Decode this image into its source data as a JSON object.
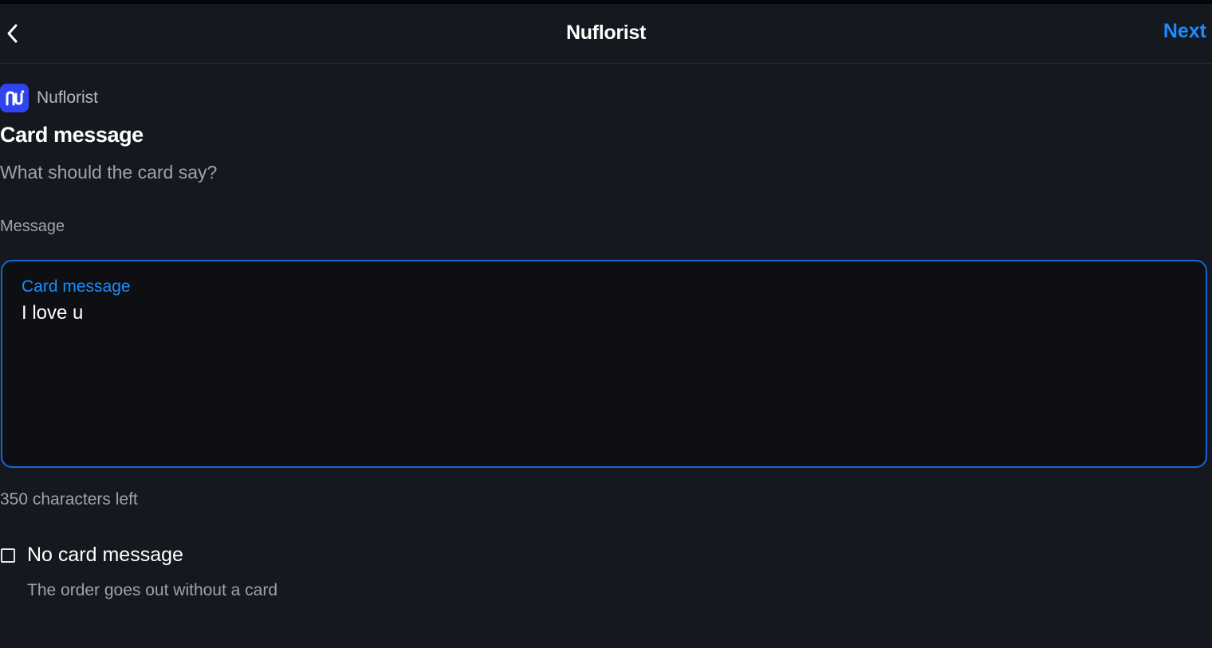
{
  "header": {
    "title": "Nuflorist",
    "next_label": "Next",
    "back_icon": "chevron-left-icon"
  },
  "brand": {
    "name": "Nuflorist",
    "logo_color": "#2f44f0"
  },
  "section": {
    "title": "Card message",
    "subtitle": "What should the card say?"
  },
  "message_field": {
    "label": "Message",
    "floating_label": "Card message",
    "value": "I love u",
    "chars_left": "350 characters left"
  },
  "no_card_option": {
    "label": "No card message",
    "description": "The order goes out without a card",
    "checked": false
  },
  "colors": {
    "background": "#15181e",
    "accent": "#1a8cff",
    "field_border": "#1565d8"
  }
}
